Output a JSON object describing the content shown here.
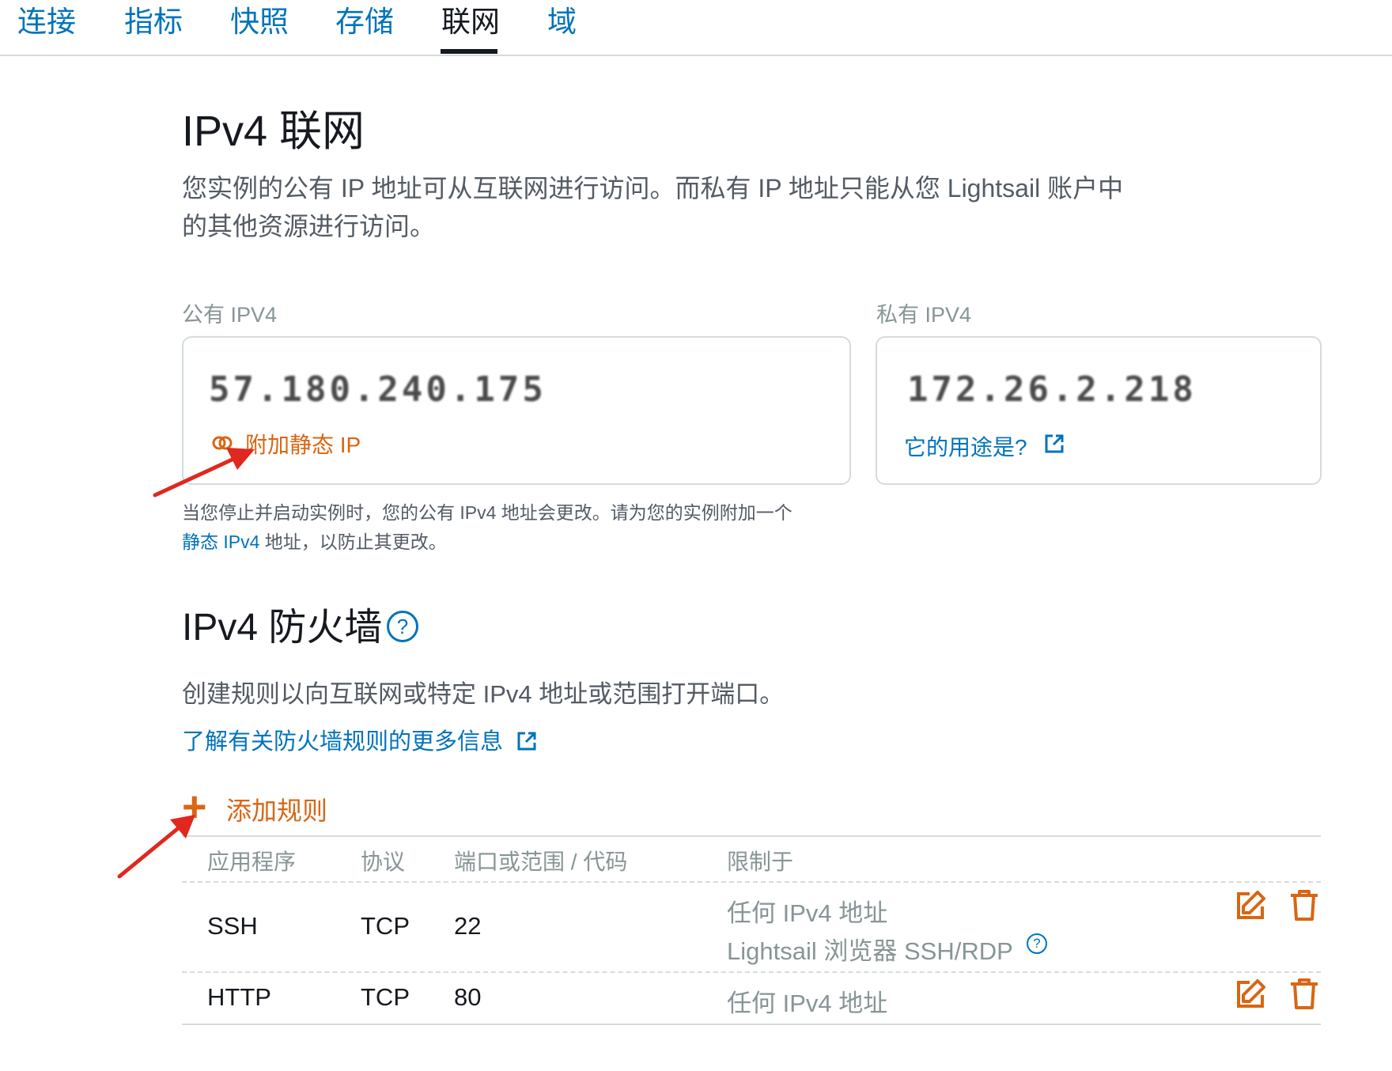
{
  "tabs": [
    "连接",
    "指标",
    "快照",
    "存储",
    "联网",
    "域"
  ],
  "active_tab": "联网",
  "ipv4_networking": {
    "title": "IPv4 联网",
    "description": "您实例的公有 IP 地址可从互联网进行访问。而私有 IP 地址只能从您 Lightsail 账户中的其他资源进行访问。",
    "public_label": "公有 IPV4",
    "public_ip": "57.180.240.175",
    "attach_static_label": "附加静态 IP",
    "private_label": "私有 IPV4",
    "private_ip": "172.26.2.218",
    "what_for_label": "它的用途是?",
    "note_text": "当您停止并启动实例时，您的公有 IPv4 地址会更改。请为您的实例附加一个",
    "note_link": "静态 IPv4",
    "note_tail": " 地址，以防止其更改。"
  },
  "firewall": {
    "title": "IPv4 防火墙",
    "help_symbol": "?",
    "description": "创建规则以向互联网或特定 IPv4 地址或范围打开端口。",
    "learn_more": "了解有关防火墙规则的更多信息",
    "add_rule": "添加规则",
    "columns": [
      "应用程序",
      "协议",
      "端口或范围 / 代码",
      "限制于"
    ],
    "rows": [
      {
        "app": "SSH",
        "protocol": "TCP",
        "port": "22",
        "restrict": "任何 IPv4 地址",
        "restrict2": "Lightsail 浏览器 SSH/RDP"
      },
      {
        "app": "HTTP",
        "protocol": "TCP",
        "port": "80",
        "restrict": "任何 IPv4 地址"
      }
    ]
  },
  "colors": {
    "accent_orange": "#d86613",
    "link_blue": "#0073bb",
    "arrow_red": "#e0281f"
  }
}
